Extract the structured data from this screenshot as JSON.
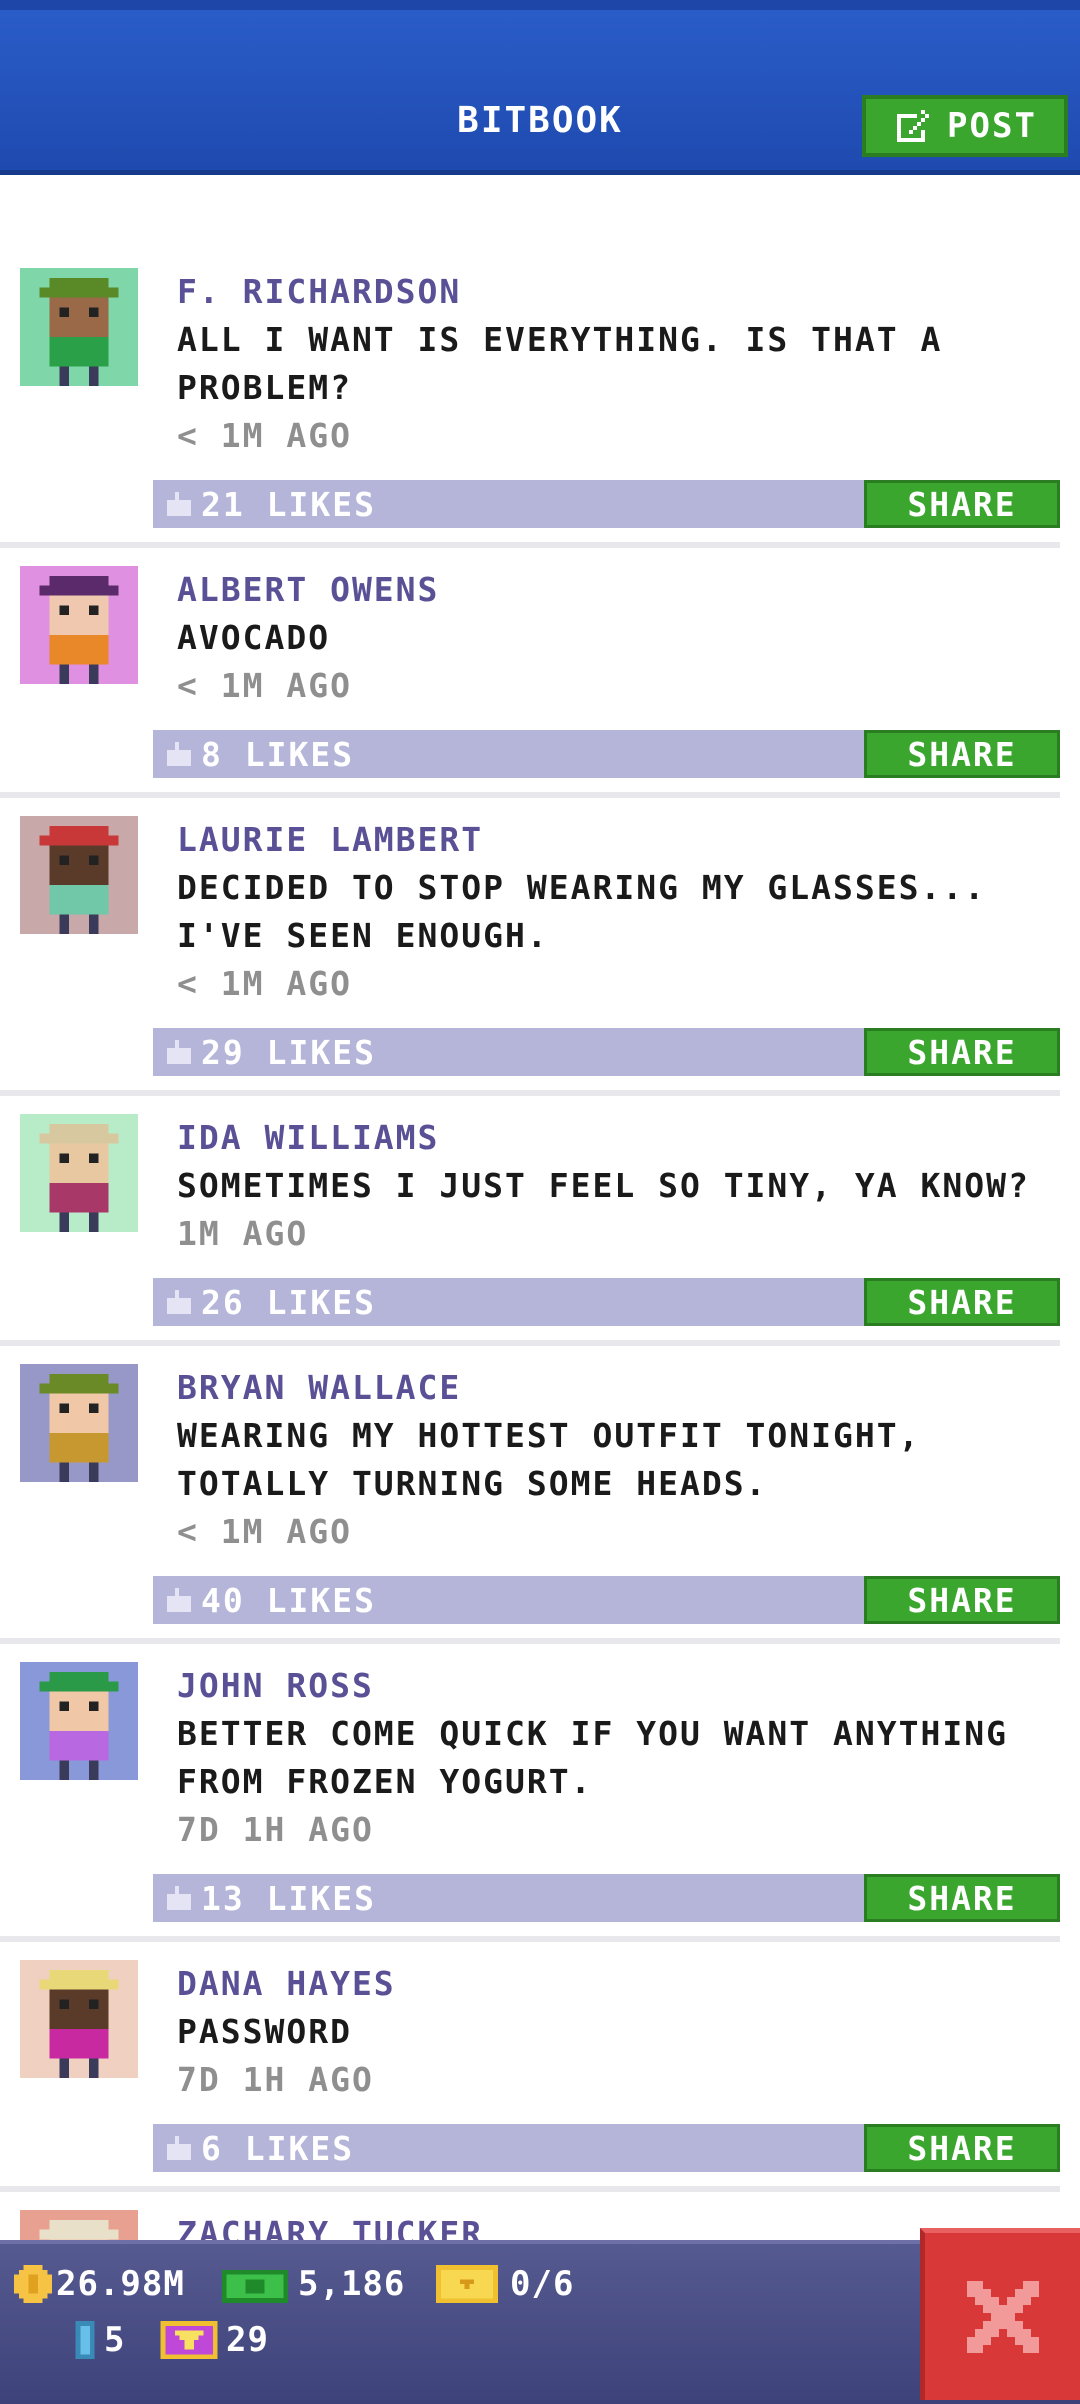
{
  "header": {
    "title": "BITBOOK",
    "post_label": "POST"
  },
  "posts": [
    {
      "author": "F. RICHARDSON",
      "message_lines": [
        "ALL I WANT IS EVERYTHING. IS THAT A",
        "PROBLEM?"
      ],
      "time": "< 1M AGO",
      "likes": "21 LIKES",
      "share": "SHARE",
      "avatar_bg": "#7fd6a8"
    },
    {
      "author": "ALBERT OWENS",
      "message_lines": [
        "AVOCADO"
      ],
      "time": "< 1M AGO",
      "likes": "8 LIKES",
      "share": "SHARE",
      "avatar_bg": "#e090e0"
    },
    {
      "author": "LAURIE LAMBERT",
      "message_lines": [
        "DECIDED TO STOP WEARING MY GLASSES...",
        "I'VE SEEN ENOUGH."
      ],
      "time": "< 1M AGO",
      "likes": "29 LIKES",
      "share": "SHARE",
      "avatar_bg": "#c8a8a8"
    },
    {
      "author": "IDA WILLIAMS",
      "message_lines": [
        "SOMETIMES I JUST FEEL SO TINY, YA KNOW?"
      ],
      "time": "1M AGO",
      "likes": "26 LIKES",
      "share": "SHARE",
      "avatar_bg": "#b8ecc8"
    },
    {
      "author": "BRYAN WALLACE",
      "message_lines": [
        "WEARING MY HOTTEST OUTFIT TONIGHT,",
        "TOTALLY TURNING SOME HEADS."
      ],
      "time": "< 1M AGO",
      "likes": "40 LIKES",
      "share": "SHARE",
      "avatar_bg": "#9898c8"
    },
    {
      "author": "JOHN ROSS",
      "message_lines": [
        "BETTER COME QUICK IF YOU WANT ANYTHING",
        "FROM FROZEN YOGURT."
      ],
      "time": "7D 1H AGO",
      "likes": "13 LIKES",
      "share": "SHARE",
      "avatar_bg": "#8898d8"
    },
    {
      "author": "DANA HAYES",
      "message_lines": [
        "PASSWORD"
      ],
      "time": "7D 1H AGO",
      "likes": "6 LIKES",
      "share": "SHARE",
      "avatar_bg": "#f0d0c0"
    },
    {
      "author": "ZACHARY TUCKER",
      "message_lines": [
        ""
      ],
      "time": "",
      "likes": "",
      "share": "",
      "avatar_bg": "#e8a090"
    }
  ],
  "status_bar": {
    "coins": "26.98M",
    "bux": "5,186",
    "tickets": "0/6",
    "elevator": "5",
    "vip": "29"
  },
  "colors": {
    "header_blue": "#2a5cc8",
    "share_green": "#3aa62e",
    "author_purple": "#5a5096",
    "likes_bar": "#b4b5d8",
    "close_red": "#d83838"
  },
  "icons": [
    "edit-icon",
    "like-icon",
    "coin-icon",
    "bux-icon",
    "ticket-icon",
    "elevator-icon",
    "vip-icon",
    "close-icon"
  ]
}
